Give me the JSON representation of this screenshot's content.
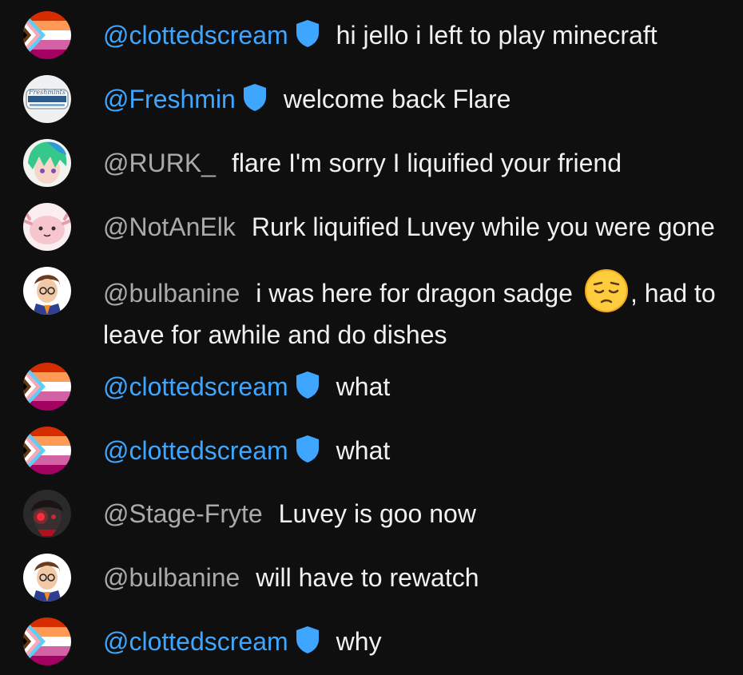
{
  "messages": [
    {
      "author": "@clottedscream",
      "text": "hi jello i left to play minecraft",
      "moderator": true,
      "avatar": "progress-pride-flag"
    },
    {
      "author": "@Freshmin",
      "text": "welcome back Flare",
      "moderator": true,
      "avatar": "freshmints-tin"
    },
    {
      "author": "@RURK_",
      "text": "flare I'm sorry I liquified your friend",
      "moderator": false,
      "avatar": "green-haired-character"
    },
    {
      "author": "@NotAnElk",
      "text": "Rurk liquified Luvey while you were gone",
      "moderator": false,
      "avatar": "pink-axolotl"
    },
    {
      "author": "@bulbanine",
      "text_before": "i was here for dragon sadge",
      "emoji": "pensive-face",
      "text_after": ", had to leave for awhile and do dishes",
      "moderator": false,
      "avatar": "glasses-character"
    },
    {
      "author": "@clottedscream",
      "text": "what",
      "moderator": true,
      "avatar": "progress-pride-flag"
    },
    {
      "author": "@clottedscream",
      "text": "what",
      "moderator": true,
      "avatar": "progress-pride-flag"
    },
    {
      "author": "@Stage-Fryte",
      "text": "Luvey is goo now",
      "moderator": false,
      "avatar": "red-eyed-character"
    },
    {
      "author": "@bulbanine",
      "text": "will have to rewatch",
      "moderator": false,
      "avatar": "glasses-character"
    },
    {
      "author": "@clottedscream",
      "text": "why",
      "moderator": true,
      "avatar": "progress-pride-flag"
    }
  ],
  "avatar_labels": {
    "freshmints_tin": "Freshmints"
  },
  "colors": {
    "background": "#0f0f0f",
    "message_text": "#f1f1f1",
    "author": "#aaaaaa",
    "moderator_author": "#3ea6ff",
    "moderator_badge": "#3ea6ff"
  }
}
